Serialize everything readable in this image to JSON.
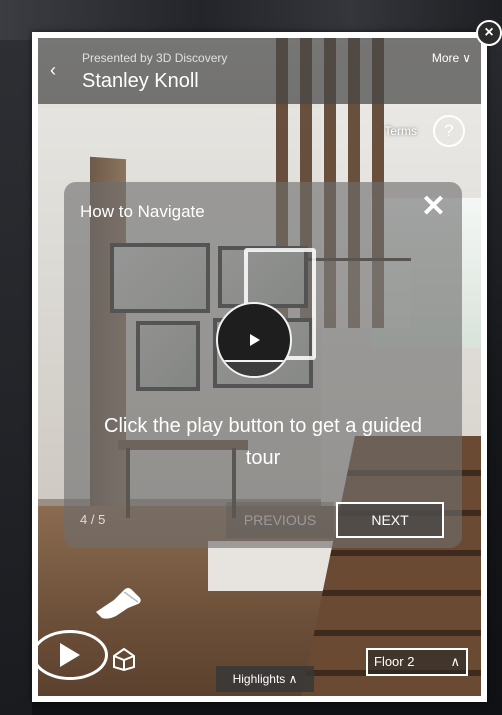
{
  "header": {
    "presented_by": "Presented by 3D Discovery",
    "title": "Stanley Knoll",
    "more_label": "More",
    "more_chevron": "∨",
    "back_glyph": "‹"
  },
  "top_actions": {
    "terms_label": "Terms",
    "help_glyph": "?"
  },
  "modal": {
    "title": "How to Navigate",
    "close_glyph": "✕",
    "message": "Click the play button to get a guided tour",
    "counter": "4 / 5",
    "previous_label": "PREVIOUS",
    "next_label": "NEXT"
  },
  "bottom_bar": {
    "highlights_label": "Highlights ∧",
    "floor_label": "Floor 2",
    "floor_chevron": "∧"
  },
  "frame": {
    "close_glyph": "×"
  },
  "icons": {
    "play": "play-icon",
    "dollhouse": "dollhouse-icon",
    "pointer": "pointing-hand-icon",
    "help": "question-icon",
    "close": "close-icon"
  },
  "colors": {
    "overlay": "#464646",
    "text": "#ffffff",
    "disabled_text": "#9a9a9a"
  }
}
